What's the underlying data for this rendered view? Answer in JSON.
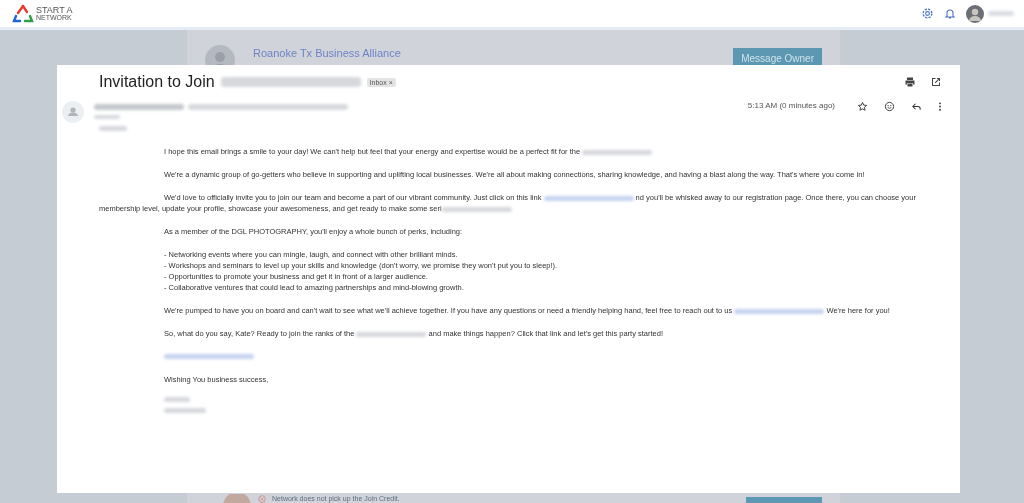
{
  "header": {
    "logo_lines": [
      "START A",
      "NETWORK"
    ]
  },
  "background_card": {
    "group_name": "Roanoke Tx Business Alliance",
    "button": "Message Owner",
    "footer_note": "Network does not pick up the Join Credit."
  },
  "email": {
    "subject": "Invitation to Join",
    "label": {
      "text": "Inbox",
      "remove": "×"
    },
    "time": "5:13 AM (0 minutes ago)",
    "blocks": [
      {
        "kind": "redacted-line"
      },
      {
        "kind": "para",
        "segments": [
          {
            "kind": "text",
            "text": "I hope this email brings a smile to your day! We can't help but feel that your energy and expertise would be a perfect fit for the "
          },
          {
            "kind": "redacted"
          }
        ]
      },
      {
        "kind": "para",
        "segments": [
          {
            "kind": "text",
            "text": "We're a dynamic group of go-getters who believe in supporting and uplifting local businesses. We're all about making connections, sharing knowledge, and having a blast along the way. That's where you come in!"
          }
        ]
      },
      {
        "kind": "para",
        "segments": [
          {
            "kind": "text",
            "text": "We'd love to officially invite you to join our team and become a part of our vibrant community. Just click on this link "
          },
          {
            "kind": "link"
          },
          {
            "kind": "text",
            "text": " nd you'll be whisked away to our registration page. Once there, you can choose your membership level, update your profile, showcase your awesomeness, and get ready to make some seri"
          },
          {
            "kind": "redacted"
          }
        ]
      },
      {
        "kind": "para",
        "segments": [
          {
            "kind": "text",
            "text": "As a member of the DGL PHOTOGRAPHY, you'll enjoy a whole bunch of perks, including:"
          }
        ]
      },
      {
        "kind": "list",
        "items": [
          "- Networking events where you can mingle, laugh, and connect with other brilliant minds.",
          "- Workshops and seminars to level up your skills and knowledge (don't worry, we promise they won't put you to sleep!).",
          "- Opportunities to promote your business and get it in front of a larger audience.",
          "- Collaborative ventures that could lead to amazing partnerships and mind-blowing growth."
        ]
      },
      {
        "kind": "para",
        "segments": [
          {
            "kind": "text",
            "text": "We're pumped to have you on board and can't wait to see what we'll achieve together. If you have any questions or need a friendly helping hand, feel free to reach out to us "
          },
          {
            "kind": "link"
          },
          {
            "kind": "text",
            "text": " We're here for you!"
          }
        ]
      },
      {
        "kind": "para",
        "segments": [
          {
            "kind": "text",
            "text": "So, what do you say, Kate? Ready to join the ranks of the "
          },
          {
            "kind": "redacted"
          },
          {
            "kind": "text",
            "text": " and make things happen? Click that link and let's get this party started!"
          }
        ]
      },
      {
        "kind": "link-line"
      },
      {
        "kind": "para",
        "segments": [
          {
            "kind": "text",
            "text": "Wishing You business success,"
          }
        ]
      },
      {
        "kind": "signature"
      }
    ]
  }
}
